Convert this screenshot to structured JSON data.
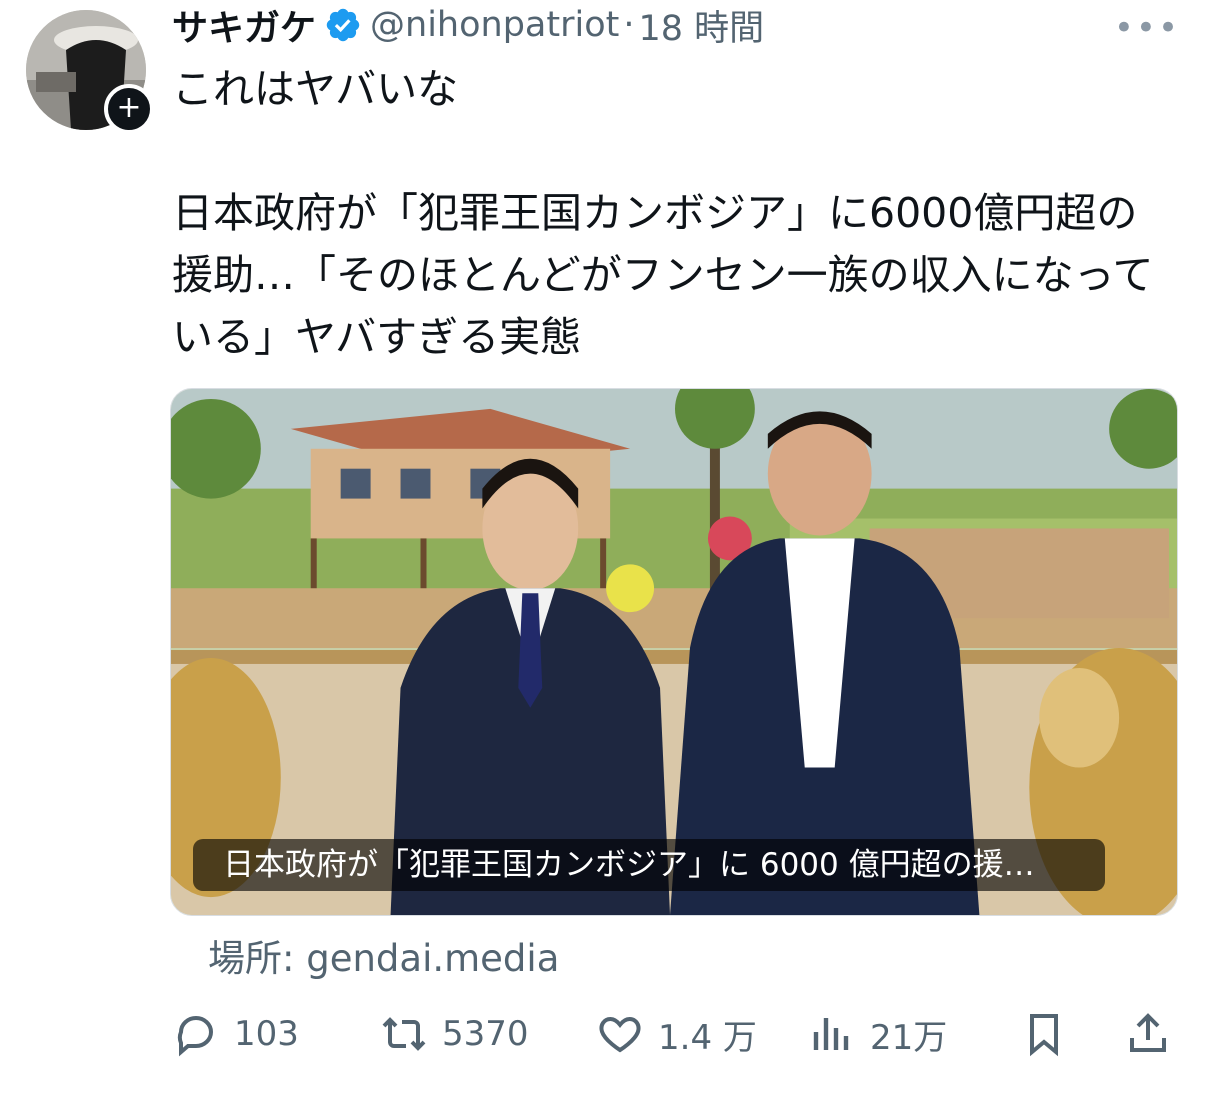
{
  "author": {
    "display_name": "サキガケ",
    "handle": "@nihonpatriot",
    "separator": "·",
    "time": "18 時間",
    "verified_color": "#1d9bf0"
  },
  "tweet": {
    "text": "これはヤバいな\n\n日本政府が「犯罪王国カンボジア」に6000億円超の援助…「そのほとんどがフンセン一族の収入になっている」ヤバすぎる実態"
  },
  "card": {
    "caption": "日本政府が「犯罪王国カンボジア」に 6000 億円超の援…",
    "source": "場所: gendai.media"
  },
  "actions": {
    "replies": "103",
    "retweets": "5370",
    "likes": "1.4 万",
    "views": "21万"
  },
  "icons": [
    "verified-badge-icon",
    "more-icon",
    "reply-icon",
    "retweet-icon",
    "like-icon",
    "views-icon",
    "bookmark-icon",
    "share-icon",
    "follow-plus-icon"
  ]
}
